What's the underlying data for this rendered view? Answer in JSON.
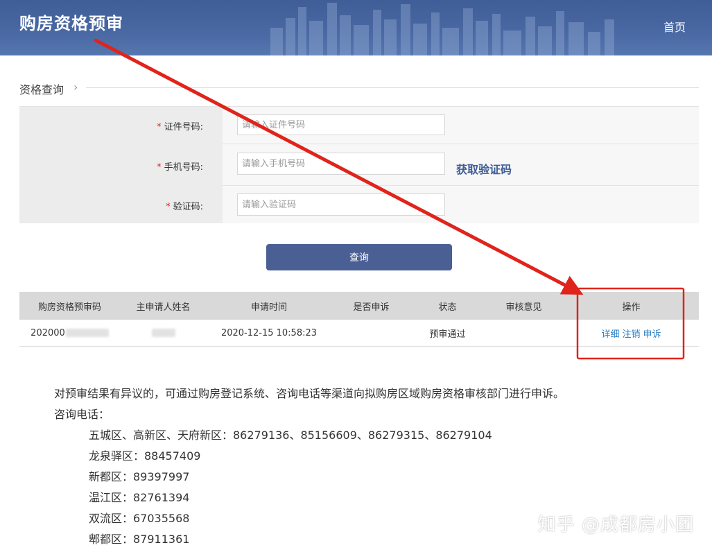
{
  "header": {
    "title": "购房资格预审",
    "home_label": "首页"
  },
  "section": {
    "title": "资格查询"
  },
  "form": {
    "id_label": "证件号码:",
    "id_placeholder": "请输入证件号码",
    "phone_label": "手机号码:",
    "phone_placeholder": "请输入手机号码",
    "get_code_label": "获取验证码",
    "code_label": "验证码:",
    "code_placeholder": "请输入验证码",
    "required_mark": "*"
  },
  "query_button": "查询",
  "table": {
    "headers": [
      "购房资格预审码",
      "主申请人姓名",
      "申请时间",
      "是否申诉",
      "状态",
      "审核意见",
      "操作"
    ],
    "row": {
      "code_prefix": "202000",
      "time": "2020-12-15 10:58:23",
      "appeal": "",
      "status": "预审通过",
      "opinion": "",
      "actions": [
        "详细",
        "注销",
        "申诉"
      ]
    }
  },
  "info": {
    "notice": "对预审结果有异议的，可通过购房登记系统、咨询电话等渠道向拟购房区域购房资格审核部门进行申诉。",
    "phone_title": "咨询电话：",
    "phones": [
      "五城区、高新区、天府新区：86279136、85156609、86279315、86279104",
      "龙泉驿区：88457409",
      "新都区：89397997",
      "温江区：82761394",
      "双流区：67035568",
      "郫都区：87911361"
    ]
  },
  "watermark": "知乎 @成都房小团",
  "colors": {
    "header_bg": "#4a69a4",
    "accent": "#3f5d96",
    "button": "#4a5f93",
    "link": "#2b7fc3",
    "annotation": "#e0241b"
  }
}
